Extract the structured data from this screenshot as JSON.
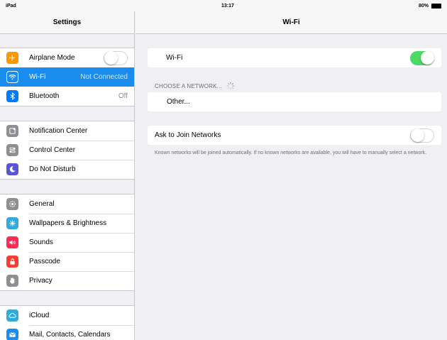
{
  "status_bar": {
    "device": "iPad",
    "time": "13:17",
    "battery": "80%"
  },
  "sidebar": {
    "title": "Settings",
    "group1": [
      {
        "label": "Airplane Mode",
        "icon": "airplane-icon",
        "color": "#ff9500",
        "toggle": "off"
      },
      {
        "label": "Wi-Fi",
        "value": "Not Connected",
        "icon": "wifi-icon",
        "color": "#1a8ced",
        "selected": true
      },
      {
        "label": "Bluetooth",
        "value": "Off",
        "icon": "bluetooth-icon",
        "color": "#007aff"
      }
    ],
    "group2": [
      {
        "label": "Notification Center",
        "icon": "notification-center-icon",
        "color": "#8e8e93"
      },
      {
        "label": "Control Center",
        "icon": "control-center-icon",
        "color": "#8e8e93"
      },
      {
        "label": "Do Not Disturb",
        "icon": "moon-icon",
        "color": "#5856d6"
      }
    ],
    "group3": [
      {
        "label": "General",
        "icon": "gear-icon",
        "color": "#8e8e93"
      },
      {
        "label": "Wallpapers & Brightness",
        "icon": "wallpaper-icon",
        "color": "#34aadc"
      },
      {
        "label": "Sounds",
        "icon": "speaker-icon",
        "color": "#ff2d55"
      },
      {
        "label": "Passcode",
        "icon": "lock-icon",
        "color": "#ff3b30"
      },
      {
        "label": "Privacy",
        "icon": "hand-icon",
        "color": "#8e8e93"
      }
    ],
    "group4": [
      {
        "label": "iCloud",
        "icon": "cloud-icon",
        "color": "#34aadc"
      },
      {
        "label": "Mail, Contacts, Calendars",
        "icon": "mail-icon",
        "color": "#1a8ced"
      }
    ]
  },
  "main": {
    "title": "Wi-Fi",
    "wifi_label": "Wi-Fi",
    "wifi_toggle": "on",
    "choose_network_label": "CHOOSE A NETWORK...",
    "other_label": "Other...",
    "ask_to_join_label": "Ask to Join Networks",
    "ask_to_join_toggle": "off",
    "footnote": "Known networks will be joined automatically. If no known networks are available, you will have to manually select a network."
  },
  "colors": {
    "accent": "#1a8ced",
    "toggle_on": "#4cd964",
    "background": "#efeff4"
  }
}
